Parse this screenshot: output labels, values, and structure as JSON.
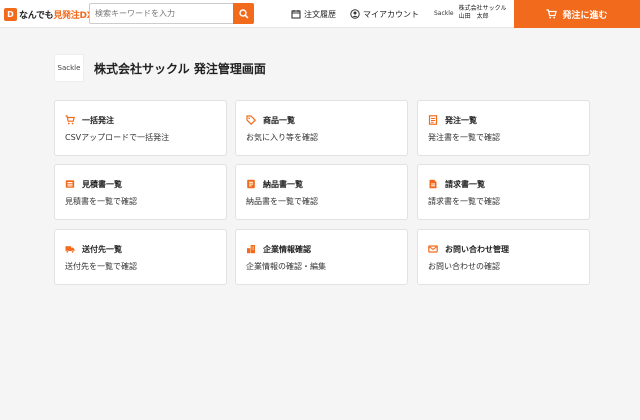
{
  "header": {
    "logo": {
      "prefix": "なんでも",
      "accent": "見発注DX"
    },
    "search": {
      "placeholder": "検索キーワードを入力"
    },
    "order_history": "注文履歴",
    "my_account": "マイアカウント",
    "user": {
      "brand": "Sackle",
      "company": "株式会社サックル",
      "name": "山田　太郎"
    },
    "order_button": "発注に進む",
    "accent_color": "#f26a1b"
  },
  "company": {
    "logo_text": "Sackle",
    "title": "株式会社サックル 発注管理画面"
  },
  "cards": [
    {
      "icon": "cart-icon",
      "title": "一括発注",
      "desc": "CSVアップロードで一括発注"
    },
    {
      "icon": "tag-icon",
      "title": "商品一覧",
      "desc": "お気に入り等を確認"
    },
    {
      "icon": "document-icon",
      "title": "発注一覧",
      "desc": "発注書を一覧で確認"
    },
    {
      "icon": "list-icon",
      "title": "見積書一覧",
      "desc": "見積書を一覧で確認"
    },
    {
      "icon": "invoice-icon",
      "title": "納品書一覧",
      "desc": "納品書を一覧で確認"
    },
    {
      "icon": "file-icon",
      "title": "請求書一覧",
      "desc": "請求書を一覧で確認"
    },
    {
      "icon": "truck-icon",
      "title": "送付先一覧",
      "desc": "送付先を一覧で確認"
    },
    {
      "icon": "building-icon",
      "title": "企業情報確認",
      "desc": "企業情報の確認・編集"
    },
    {
      "icon": "mail-icon",
      "title": "お問い合わせ管理",
      "desc": "お問い合わせの確認"
    }
  ]
}
